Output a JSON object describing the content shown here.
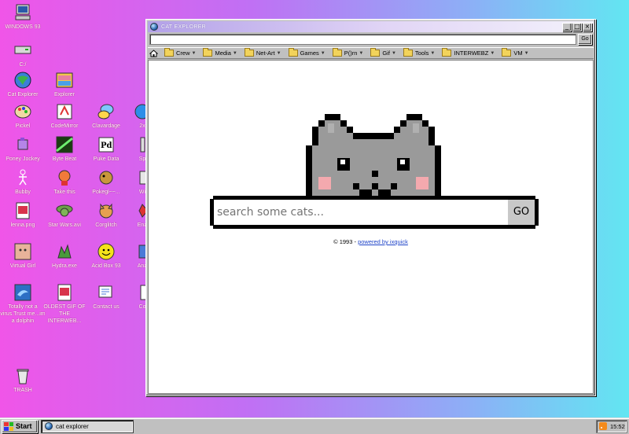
{
  "desktop": {
    "icons": [
      {
        "label": "WINDOWS 93"
      },
      {
        "label": "C:/"
      },
      {
        "label": "Cat Explorer"
      },
      {
        "label": "Explorer"
      },
      {
        "label": "Pickel"
      },
      {
        "label": "CodeMirror"
      },
      {
        "label": "Clavardage"
      },
      {
        "label": "2x"
      },
      {
        "label": "Poney Jockey"
      },
      {
        "label": "Byte Beat"
      },
      {
        "label": "Puke Data"
      },
      {
        "label": "Sp"
      },
      {
        "label": "Bubby"
      },
      {
        "label": "Take this"
      },
      {
        "label": "Pokegl~~..."
      },
      {
        "label": "Wi"
      },
      {
        "label": "lenna.png"
      },
      {
        "label": "Star Wars.avi"
      },
      {
        "label": "Corglitch"
      },
      {
        "label": "Ena"
      },
      {
        "label": "Virtual Girl"
      },
      {
        "label": "Hydra.exe"
      },
      {
        "label": "Acid Box 93"
      },
      {
        "label": "Ana"
      },
      {
        "label": "Totally not a virus.Trust me...im a dolphin"
      },
      {
        "label": "OLDEST GIF OF THE INTERWEB..."
      },
      {
        "label": "Contact us"
      },
      {
        "label": "Co"
      },
      {
        "label": "TRASH"
      }
    ]
  },
  "window": {
    "title": "CAT EXPLORER",
    "controls": {
      "minimize": "_",
      "maximize": "□",
      "close": "×"
    },
    "address": {
      "value": "",
      "go_label": "Go"
    },
    "bookmarks": [
      {
        "label": "Crew"
      },
      {
        "label": "Media"
      },
      {
        "label": "Net-Art"
      },
      {
        "label": "Games"
      },
      {
        "label": "P()rn"
      },
      {
        "label": "Gif"
      },
      {
        "label": "Tools"
      },
      {
        "label": "INTERWEBZ"
      },
      {
        "label": "VM"
      }
    ],
    "search": {
      "placeholder": "search some cats...",
      "go_label": "GO"
    },
    "footer": {
      "prefix": "©  1993 - ",
      "link": "powered by ixquick"
    }
  },
  "taskbar": {
    "start_label": "Start",
    "tasks": [
      {
        "label": "cat explorer"
      }
    ],
    "clock": "15:52"
  },
  "colors": {
    "desktop_gradient": [
      "#f055e8",
      "#c070f4",
      "#8cb0f6",
      "#62e6f2"
    ],
    "window_face": "#c0c0c0",
    "link": "#1f44c8",
    "cat_gray": "#9a9a9a",
    "cat_blush": "#f4a9ae"
  }
}
